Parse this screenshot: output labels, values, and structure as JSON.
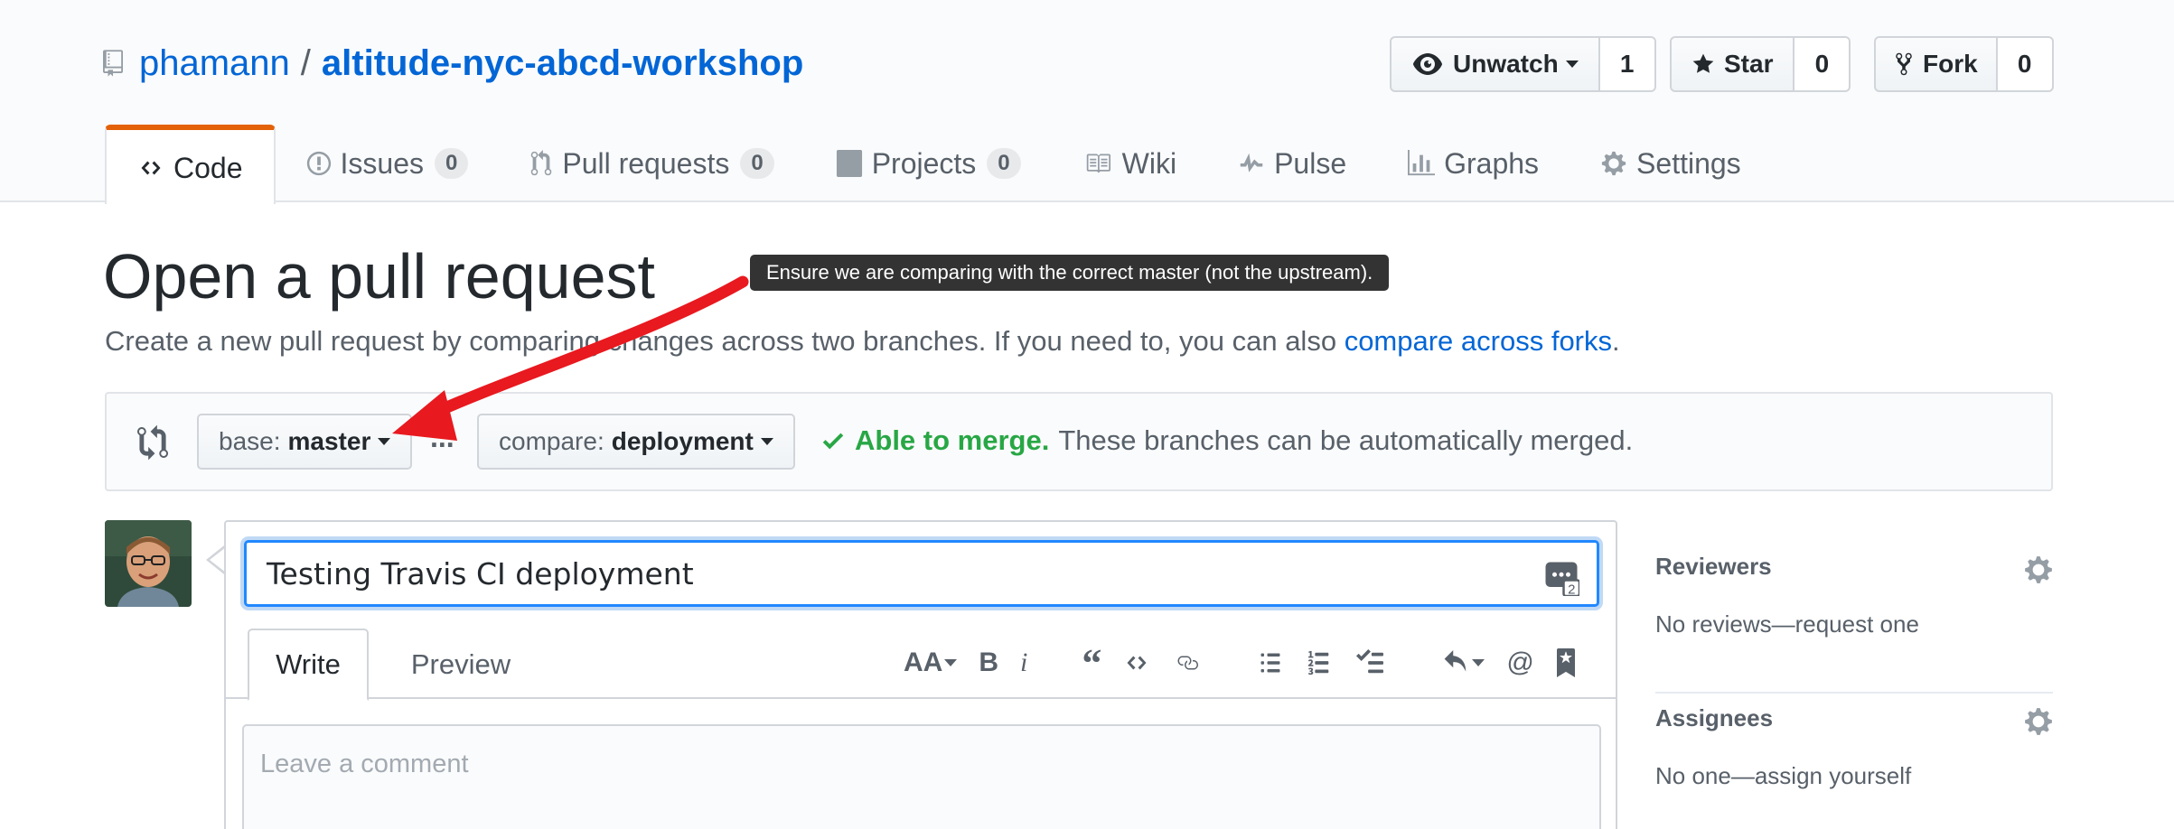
{
  "repo": {
    "owner": "phamann",
    "separator": "/",
    "name": "altitude-nyc-abcd-workshop"
  },
  "actions": {
    "watch": {
      "label": "Unwatch",
      "count": "1"
    },
    "star": {
      "label": "Star",
      "count": "0"
    },
    "fork": {
      "label": "Fork",
      "count": "0"
    }
  },
  "tabs": [
    {
      "label": "Code",
      "icon": "code-icon"
    },
    {
      "label": "Issues",
      "count": "0",
      "icon": "issue-icon"
    },
    {
      "label": "Pull requests",
      "count": "0",
      "icon": "pull-request-icon"
    },
    {
      "label": "Projects",
      "count": "0",
      "icon": "project-icon"
    },
    {
      "label": "Wiki",
      "icon": "book-icon"
    },
    {
      "label": "Pulse",
      "icon": "pulse-icon"
    },
    {
      "label": "Graphs",
      "icon": "graph-icon"
    },
    {
      "label": "Settings",
      "icon": "gear-icon"
    }
  ],
  "page": {
    "title": "Open a pull request",
    "subtitle": "Create a new pull request by comparing changes across two branches. If you need to, you can also ",
    "subtitle_link": "compare across forks",
    "subtitle_end": "."
  },
  "tooltip": "Ensure we are comparing with the correct master (not the upstream).",
  "compare": {
    "base_prefix": "base:",
    "base_branch": "master",
    "dots": "...",
    "compare_prefix": "compare:",
    "compare_branch": "deployment",
    "merge_ok": "Able to merge.",
    "merge_text": "These branches can be automatically merged."
  },
  "form": {
    "title_value": "Testing Travis CI deployment",
    "tab_write": "Write",
    "tab_preview": "Preview",
    "comment_placeholder": "Leave a comment",
    "toolbar_icons": [
      "text-size-icon",
      "bold-icon",
      "italic-icon",
      "quote-icon",
      "code-icon",
      "link-icon",
      "unordered-list-icon",
      "ordered-list-icon",
      "task-list-icon",
      "reply-icon",
      "mention-icon",
      "bookmark-icon"
    ]
  },
  "sidebar": {
    "reviewers": {
      "heading": "Reviewers",
      "value": "No reviews—request one"
    },
    "assignees": {
      "heading": "Assignees",
      "value": "No one—assign yourself"
    }
  },
  "colors": {
    "link": "#0366d6",
    "tab_accent": "#e36209",
    "success": "#28a745",
    "annotation_arrow": "#e8191f"
  }
}
